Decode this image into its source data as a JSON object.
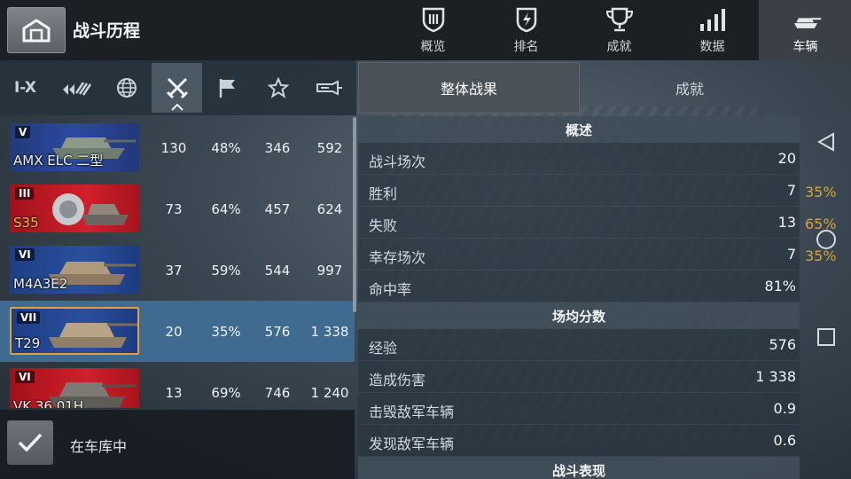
{
  "header": {
    "title": "战斗历程",
    "tabs": [
      {
        "label": "概览",
        "icon": "shield-icon"
      },
      {
        "label": "排名",
        "icon": "badge-icon"
      },
      {
        "label": "成就",
        "icon": "trophy-icon"
      },
      {
        "label": "数据",
        "icon": "bars-icon"
      },
      {
        "label": "车辆",
        "icon": "tank-icon",
        "active": true
      }
    ]
  },
  "filters": [
    {
      "label": "I-X",
      "icon": ""
    },
    {
      "label": "",
      "icon": "tank-type-icon"
    },
    {
      "label": "",
      "icon": "globe-icon"
    },
    {
      "label": "",
      "icon": "crossed-swords-icon",
      "active": true
    },
    {
      "label": "",
      "icon": "flag-icon"
    },
    {
      "label": "",
      "icon": "star-icon"
    },
    {
      "label": "",
      "icon": "cannon-icon"
    }
  ],
  "segments": [
    {
      "label": "整体战果",
      "active": true
    },
    {
      "label": "成就"
    }
  ],
  "tanks": [
    {
      "name": "AMX ELC 二型",
      "tier": "V",
      "nation": "fr",
      "battles": "130",
      "winrate": "48%",
      "avg": "346",
      "best": "592"
    },
    {
      "name": "S35",
      "tier": "III",
      "nation": "de",
      "gold": true,
      "battles": "73",
      "winrate": "64%",
      "avg": "457",
      "best": "624"
    },
    {
      "name": "M4A3E2",
      "tier": "VI",
      "nation": "us",
      "battles": "37",
      "winrate": "59%",
      "avg": "544",
      "best": "997"
    },
    {
      "name": "T29",
      "tier": "VII",
      "nation": "us",
      "selected": true,
      "battles": "20",
      "winrate": "35%",
      "avg": "576",
      "best": "1 338"
    },
    {
      "name": "VK 36.01H",
      "tier": "VI",
      "nation": "de",
      "battles": "13",
      "winrate": "69%",
      "avg": "746",
      "best": "1 240"
    }
  ],
  "bottom": {
    "label": "在车库中"
  },
  "details": {
    "overview_title": "概述",
    "overview": [
      {
        "label": "战斗场次",
        "value": "20",
        "pct": ""
      },
      {
        "label": "胜利",
        "value": "7",
        "pct": "35%"
      },
      {
        "label": "失败",
        "value": "13",
        "pct": "65%"
      },
      {
        "label": "幸存场次",
        "value": "7",
        "pct": "35%"
      },
      {
        "label": "命中率",
        "value": "81%",
        "pct": ""
      }
    ],
    "avg_title": "场均分数",
    "avg": [
      {
        "label": "经验",
        "value": "576"
      },
      {
        "label": "造成伤害",
        "value": "1 338"
      },
      {
        "label": "击毁敌军车辆",
        "value": "0.9"
      },
      {
        "label": "发现敌军车辆",
        "value": "0.6"
      }
    ],
    "perf_title": "战斗表现"
  },
  "colors": {
    "accent_gold": "#d9a430",
    "selected_row": "#3f6b91"
  }
}
